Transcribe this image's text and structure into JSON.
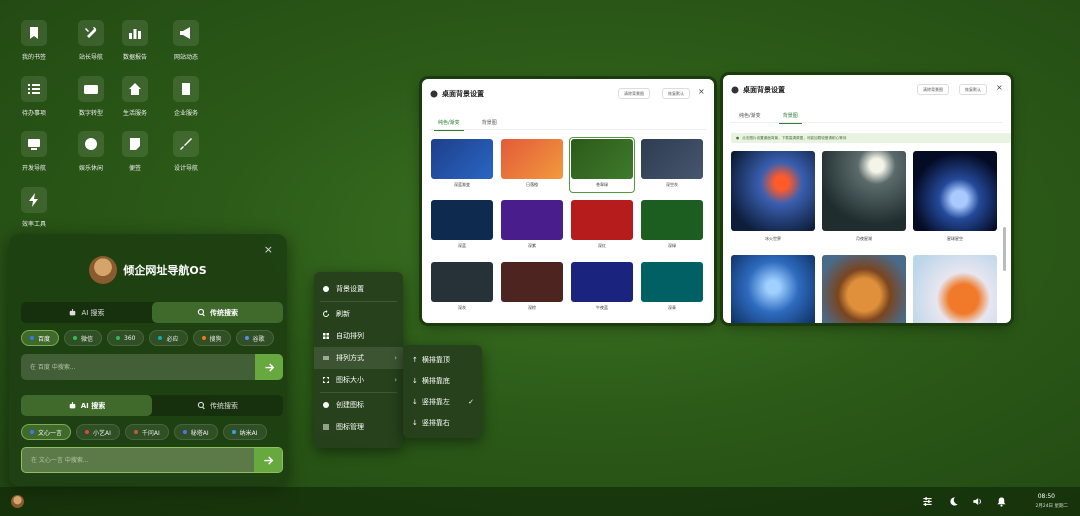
{
  "desktop": {
    "icons": [
      {
        "label": "我的书签",
        "icon": "bookmark-icon"
      },
      {
        "label": "站长导航",
        "icon": "tools-icon"
      },
      {
        "label": "数据报告",
        "icon": "chart-icon"
      },
      {
        "label": "网站动态",
        "icon": "megaphone-icon"
      },
      {
        "label": "待办事项",
        "icon": "checklist-icon"
      },
      {
        "label": "数字转型",
        "icon": "card-icon"
      },
      {
        "label": "生活服务",
        "icon": "home-icon"
      },
      {
        "label": "企业服务",
        "icon": "building-icon"
      },
      {
        "label": "开发导航",
        "icon": "monitor-icon"
      },
      {
        "label": "娱乐休闲",
        "icon": "smile-icon"
      },
      {
        "label": "便签",
        "icon": "note-icon"
      },
      {
        "label": "设计导航",
        "icon": "brush-icon"
      },
      {
        "label": "效率工具",
        "icon": "bolt-icon"
      }
    ]
  },
  "search_panel": {
    "title": "倾企网址导航OS",
    "close": "×",
    "modes_top": [
      {
        "label": "AI 搜索",
        "active": false
      },
      {
        "label": "传统搜索",
        "active": true
      }
    ],
    "engines": [
      {
        "label": "百度",
        "color": "#2d7cf6",
        "active": true
      },
      {
        "label": "微信",
        "color": "#3cba54",
        "active": false
      },
      {
        "label": "360",
        "color": "#2fb75a",
        "active": false
      },
      {
        "label": "必应",
        "color": "#1aa8b0",
        "active": false
      },
      {
        "label": "搜狗",
        "color": "#f07a1d",
        "active": false
      },
      {
        "label": "谷歌",
        "color": "#5a8bf2",
        "active": false
      }
    ],
    "search_placeholder": "在 百度 中搜索...",
    "modes_bottom": [
      {
        "label": "AI 搜索",
        "active": true
      },
      {
        "label": "传统搜索",
        "active": false
      }
    ],
    "ai_engines": [
      {
        "label": "文心一言",
        "color": "#3a78ff",
        "active": true
      },
      {
        "label": "小艺AI",
        "color": "#e04545",
        "active": false
      },
      {
        "label": "千问AI",
        "color": "#d0553a",
        "active": false
      },
      {
        "label": "秘塔AI",
        "color": "#5a6ef0",
        "active": false
      },
      {
        "label": "纳米AI",
        "color": "#3aa0e0",
        "active": false
      }
    ],
    "ai_placeholder": "在 文心一言 中搜索..."
  },
  "context_menu": {
    "items": [
      {
        "label": "背景设置",
        "icon": "palette-icon"
      },
      {
        "label": "刷新",
        "icon": "refresh-icon"
      },
      {
        "label": "自动排列",
        "icon": "grid-icon"
      },
      {
        "label": "排列方式",
        "icon": "lines-icon",
        "has_sub": true
      },
      {
        "label": "图标大小",
        "icon": "expand-icon",
        "has_sub": true
      },
      {
        "label": "创建图标",
        "icon": "plus-circle-icon"
      },
      {
        "label": "图标管理",
        "icon": "sliders-icon"
      }
    ],
    "submenu": [
      {
        "label": "横排靠顶",
        "arrow": "↑",
        "checked": false
      },
      {
        "label": "横排靠底",
        "arrow": "↓",
        "checked": false
      },
      {
        "label": "竖排靠左",
        "arrow": "↓",
        "checked": true
      },
      {
        "label": "竖排靠右",
        "arrow": "↓",
        "checked": false
      }
    ]
  },
  "bg_window_1": {
    "title": "桌面背景设置",
    "btn_clear": "清除背景图",
    "btn_reset": "恢复默认",
    "close": "×",
    "tabs": [
      "纯色/渐变",
      "背景图"
    ],
    "active_tab": 0,
    "swatches": [
      {
        "label": "深蓝渐变",
        "color": "linear-gradient(135deg,#1e3f8a,#2a66c4)"
      },
      {
        "label": "日落橙",
        "color": "linear-gradient(135deg,#e35a3a,#f29a3c)"
      },
      {
        "label": "苍翠绿",
        "color": "linear-gradient(135deg,#2c5a1a,#3f7a2c)",
        "selected": true
      },
      {
        "label": "深空灰",
        "color": "linear-gradient(135deg,#2f3c52,#46566e)"
      },
      {
        "label": "深蓝",
        "color": "#0e2a4f"
      },
      {
        "label": "深紫",
        "color": "#4a1d8c"
      },
      {
        "label": "深红",
        "color": "#b71c1c"
      },
      {
        "label": "深绿",
        "color": "#1b5e20"
      },
      {
        "label": "深灰",
        "color": "#263238"
      },
      {
        "label": "深棕",
        "color": "#4e2420"
      },
      {
        "label": "午夜蓝",
        "color": "#1a237e"
      },
      {
        "label": "深青",
        "color": "#006064"
      }
    ]
  },
  "bg_window_2": {
    "title": "桌面背景设置",
    "btn_clear": "清除背景图",
    "btn_reset": "恢复默认",
    "close": "×",
    "tabs": [
      "纯色/渐变",
      "背景图"
    ],
    "active_tab": 1,
    "notice": "点击图片设置桌面背景，下载高清原图，可能加载较慢请耐心等待",
    "images": [
      {
        "label": "冰火世界"
      },
      {
        "label": "月夜星湖"
      },
      {
        "label": "星球星空"
      }
    ]
  },
  "taskbar": {
    "time": "08:50",
    "date": "2月24日 星期二"
  }
}
